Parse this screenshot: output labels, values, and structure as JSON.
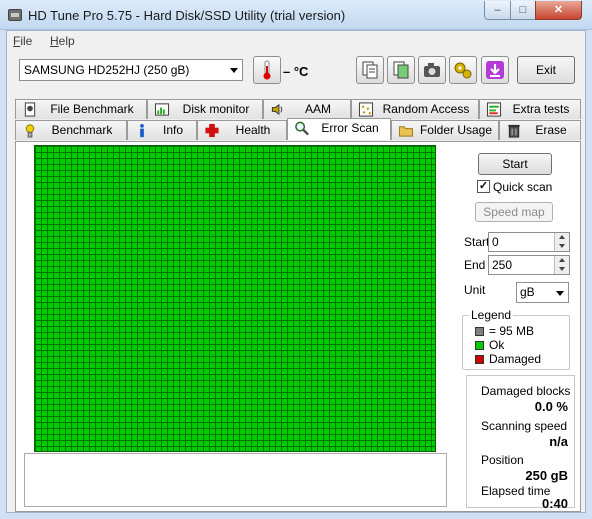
{
  "window": {
    "title": "HD Tune Pro 5.75 - Hard Disk/SSD Utility (trial version)",
    "minimize": "–",
    "maximize": "□",
    "close": "✕"
  },
  "menu": [
    "File",
    "Help"
  ],
  "toolbar": {
    "drive": "SAMSUNG HD252HJ (250 gB)",
    "temperature": "– °C",
    "exit_label": "Exit",
    "icons": [
      "thermometer-icon",
      "copy-info-icon",
      "copy-screen-icon",
      "screenshot-icon",
      "options-icon",
      "save-icon"
    ]
  },
  "tabs_row1": [
    {
      "label": "File Benchmark",
      "icon": "file-benchmark-icon"
    },
    {
      "label": "Disk monitor",
      "icon": "disk-monitor-icon"
    },
    {
      "label": "AAM",
      "icon": "aam-speaker-icon"
    },
    {
      "label": "Random Access",
      "icon": "random-access-icon"
    },
    {
      "label": "Extra tests",
      "icon": "extra-tests-icon"
    }
  ],
  "tabs_row2": [
    {
      "label": "Benchmark",
      "icon": "benchmark-icon"
    },
    {
      "label": "Info",
      "icon": "info-icon"
    },
    {
      "label": "Health",
      "icon": "health-icon"
    },
    {
      "label": "Error Scan",
      "icon": "error-scan-icon",
      "active": true
    },
    {
      "label": "Folder Usage",
      "icon": "folder-icon"
    },
    {
      "label": "Erase",
      "icon": "erase-icon"
    }
  ],
  "scan": {
    "start_label": "Start",
    "quick_scan_label": "Quick scan",
    "quick_scan_checked": true,
    "speed_map_label": "Speed map",
    "start_field_label": "Start",
    "start_value": "0",
    "end_field_label": "End",
    "end_value": "250",
    "unit_label": "Unit",
    "unit_value": "gB"
  },
  "legend": {
    "title": "Legend",
    "block_size": "= 95 MB",
    "ok": "Ok",
    "damaged": "Damaged",
    "colors": {
      "block": "#808080",
      "ok": "#00cc00",
      "damaged": "#cc0000"
    }
  },
  "stats": {
    "damaged_blocks_label": "Damaged blocks",
    "damaged_blocks_value": "0.0 %",
    "scanning_speed_label": "Scanning speed",
    "scanning_speed_value": "n/a",
    "position_label": "Position",
    "position_value": "250 gB",
    "elapsed_label": "Elapsed time",
    "elapsed_value": "0:40"
  },
  "colors": {
    "scan_ok": "#00cc00",
    "grid_line": "#007400"
  }
}
